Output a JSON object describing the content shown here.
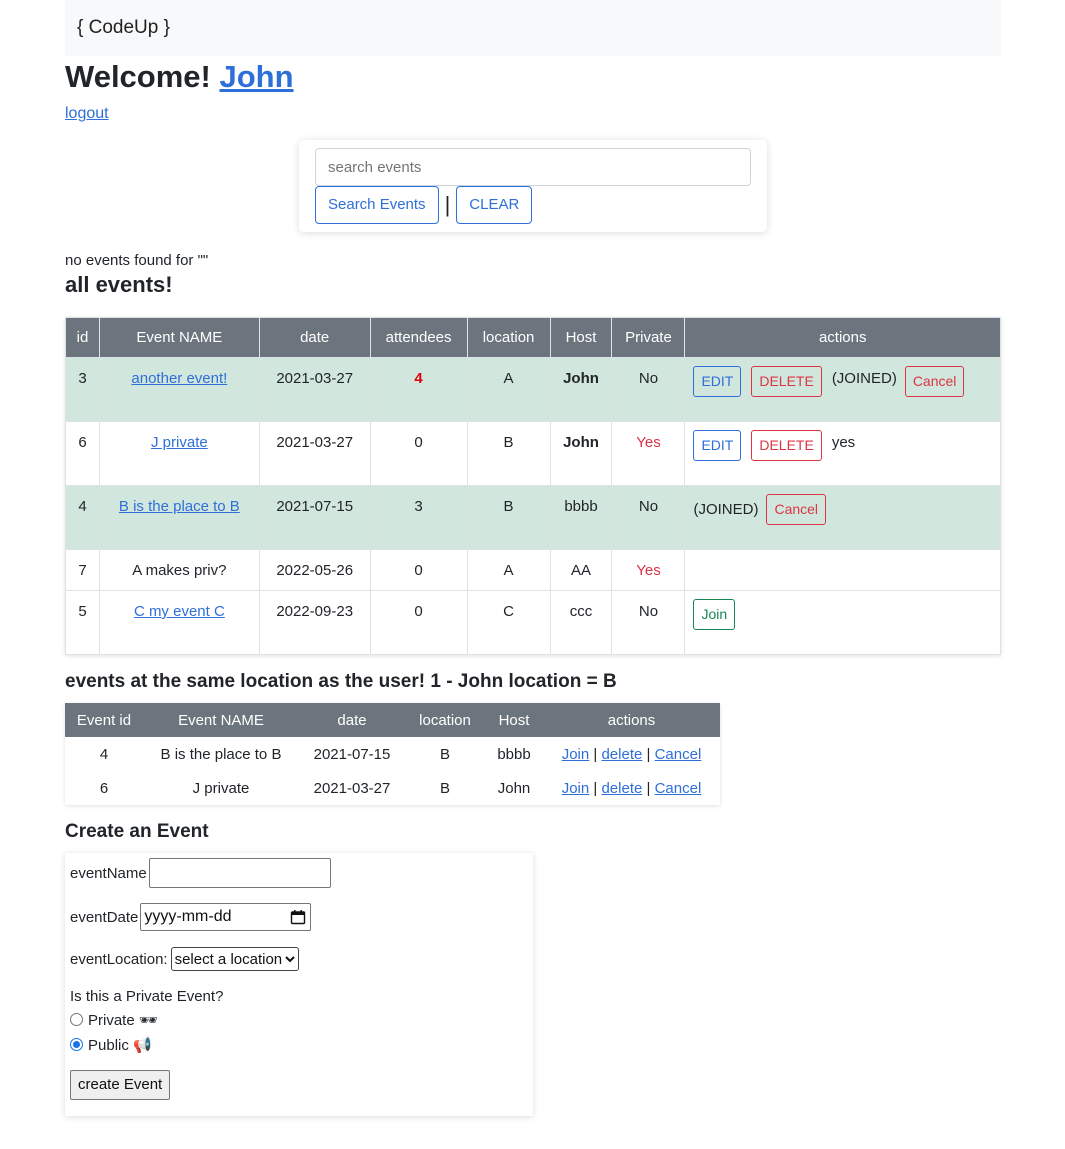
{
  "nav": {
    "brand": "{ CodeUp }"
  },
  "welcome": {
    "text": "Welcome! ",
    "user": "John"
  },
  "logout": "logout",
  "search": {
    "placeholder": "search events",
    "search_label": "Search Events",
    "separator": "|",
    "clear_label": "CLEAR"
  },
  "no_results": "no events found for \"\"",
  "all_events": {
    "heading": "all events!",
    "columns": [
      "id",
      "Event NAME",
      "date",
      "attendees",
      "location",
      "Host",
      "Private",
      "actions"
    ],
    "rows": [
      {
        "id": "3",
        "name": "another event!",
        "date": "2021-03-27",
        "attendees": "4",
        "location": "A",
        "host": "John",
        "private": "No",
        "joined_text": "(JOINED)",
        "edit": "EDIT",
        "delete": "DELETE",
        "cancel": "Cancel"
      },
      {
        "id": "6",
        "name": "J private",
        "date": "2021-03-27",
        "attendees": "0",
        "location": "B",
        "host": "John",
        "private": "Yes",
        "edit": "EDIT",
        "delete": "DELETE",
        "extra": "yes"
      },
      {
        "id": "4",
        "name": "B is the place to B",
        "date": "2021-07-15",
        "attendees": "3",
        "location": "B",
        "host": "bbbb",
        "private": "No",
        "joined_text": "(JOINED)",
        "cancel": "Cancel"
      },
      {
        "id": "7",
        "name": "A makes priv?",
        "date": "2022-05-26",
        "attendees": "0",
        "location": "A",
        "host": "AA",
        "private": "Yes"
      },
      {
        "id": "5",
        "name": "C my event C",
        "date": "2022-09-23",
        "attendees": "0",
        "location": "C",
        "host": "ccc",
        "private": "No",
        "join": "Join"
      }
    ]
  },
  "same_location": {
    "heading": "events at the same location as the user! 1 - John location = B",
    "columns": [
      "Event id",
      "Event NAME",
      "date",
      "location",
      "Host",
      "actions"
    ],
    "rows": [
      {
        "id": "4",
        "name": "B is the place to B",
        "date": "2021-07-15",
        "location": "B",
        "host": "bbbb",
        "join": "Join",
        "delete": "delete",
        "cancel": "Cancel"
      },
      {
        "id": "6",
        "name": "J private",
        "date": "2021-03-27",
        "location": "B",
        "host": "John",
        "join": "Join",
        "delete": "delete",
        "cancel": "Cancel"
      }
    ]
  },
  "create": {
    "heading": "Create an Event",
    "name_label": "eventName",
    "date_label": "eventDate",
    "date_placeholder": "yyyy-mm-dd",
    "location_label": "eventLocation:",
    "location_selected": "select a location",
    "private_question": "Is this a Private Event?",
    "private_option": "Private 🕶",
    "public_option": "Public 📢",
    "submit": "create Event"
  },
  "colors": {
    "link": "#2e6fd9",
    "danger": "#dc3545",
    "success": "#198754",
    "header_bg": "#6c757d",
    "joined_row": "#d1e7dd"
  }
}
